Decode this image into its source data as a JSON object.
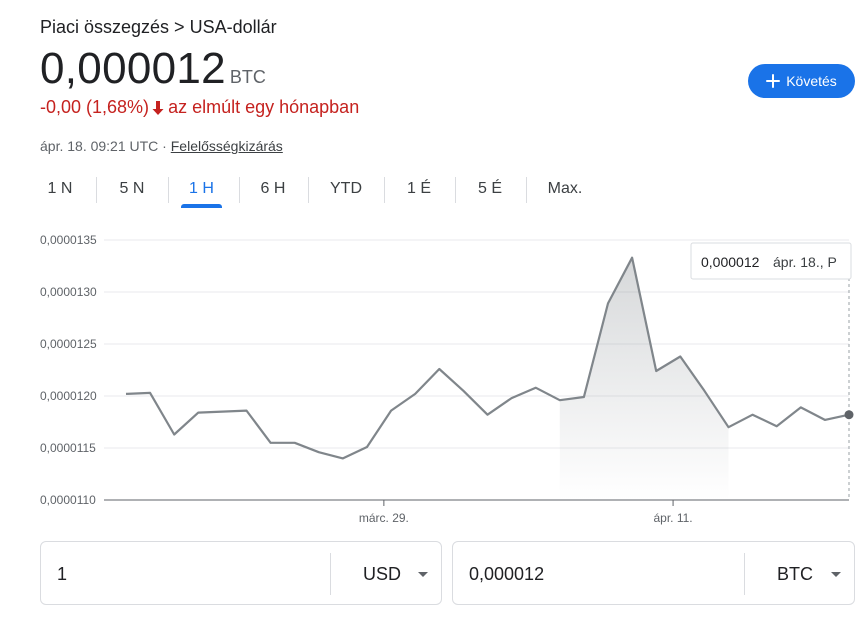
{
  "header": {
    "breadcrumb": "Piaci összegzés > USA-dollár",
    "price": "0,000012",
    "price_unit": "BTC",
    "change_text": "-0,00 (1,68%)",
    "change_period": "az elmúlt egy hónapban",
    "timestamp": "ápr. 18. 09:21 UTC",
    "separator": " · ",
    "disclaimer_label": "Felelősségkizárás",
    "follow_label": "Követés"
  },
  "tabs": [
    {
      "label": "1 N"
    },
    {
      "label": "5 N"
    },
    {
      "label": "1 H"
    },
    {
      "label": "6 H"
    },
    {
      "label": "YTD"
    },
    {
      "label": "1 É"
    },
    {
      "label": "5 É"
    },
    {
      "label": "Max."
    }
  ],
  "active_tab": 2,
  "colors": {
    "line": "#80868b",
    "accent": "#1a73e8",
    "negative": "#c5221f",
    "grid": "#e8eaed"
  },
  "tooltip": {
    "value": "0,000012",
    "date": "ápr. 18., P"
  },
  "chart_data": {
    "type": "area",
    "y_tick_labels": [
      "0,0000135",
      "0,0000130",
      "0,0000125",
      "0,0000120",
      "0,0000115",
      "0,0000110"
    ],
    "y_ticks": [
      1.35e-05,
      1.3e-05,
      1.25e-05,
      1.2e-05,
      1.15e-05,
      1.1e-05
    ],
    "ylim": [
      1.1e-05,
      1.35e-05
    ],
    "x_tick_labels": [
      {
        "label": "márc. 29.",
        "index": 10.7
      },
      {
        "label": "ápr. 11.",
        "index": 22.7
      }
    ],
    "grid": true,
    "series": [
      {
        "values": [
          1.202e-05,
          1.203e-05,
          1.163e-05,
          1.184e-05,
          1.185e-05,
          1.186e-05,
          1.155e-05,
          1.155e-05,
          1.146e-05,
          1.14e-05,
          1.151e-05,
          1.186e-05,
          1.202e-05,
          1.226e-05,
          1.205e-05,
          1.182e-05,
          1.198e-05,
          1.208e-05,
          1.196e-05,
          1.199e-05,
          1.289e-05,
          1.333e-05,
          1.224e-05,
          1.238e-05,
          1.205e-05,
          1.17e-05,
          1.182e-05,
          1.171e-05,
          1.189e-05,
          1.177e-05,
          1.182e-05
        ]
      }
    ]
  },
  "converter": {
    "from_value": "1",
    "from_currency": "USD",
    "to_value": "0,000012",
    "to_currency": "BTC"
  }
}
